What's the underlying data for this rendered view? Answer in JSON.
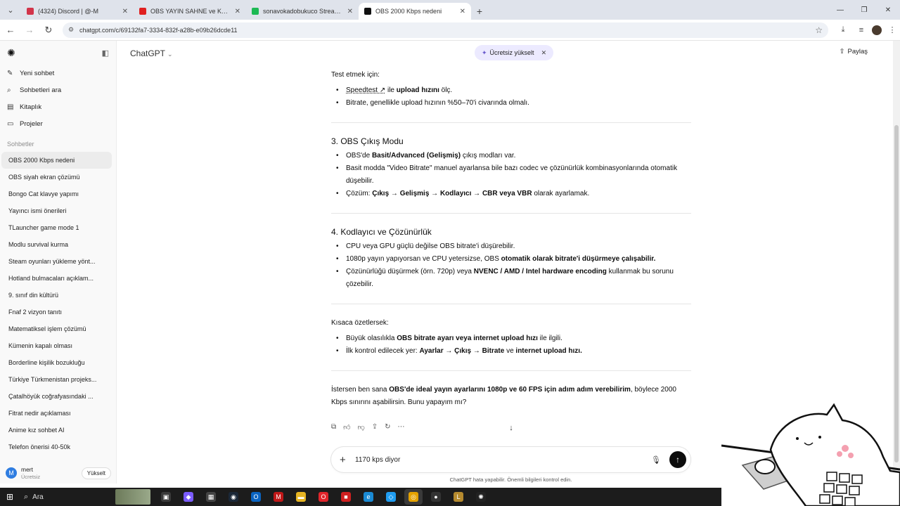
{
  "browser": {
    "tabs": [
      {
        "label": "(4324) Discord | @-M",
        "favicon_color": "#d2344a"
      },
      {
        "label": "OBS YAYIN SAHNE ve KAYNAK",
        "favicon_color": "#e02020"
      },
      {
        "label": "sonavokadobukuco Stream - W",
        "favicon_color": "#1db954"
      },
      {
        "label": "OBS 2000 Kbps nedeni",
        "favicon_color": "#111111"
      }
    ],
    "url": "chatgpt.com/c/69132fa7-3334-832f-a28b-e09b26dcde11"
  },
  "sidebar": {
    "actions": [
      {
        "icon": "edit-icon",
        "glyph": "✎",
        "label": "Yeni sohbet"
      },
      {
        "icon": "search-icon",
        "glyph": "⌕",
        "label": "Sohbetleri ara"
      },
      {
        "icon": "library-icon",
        "glyph": "▤",
        "label": "Kitaplık"
      },
      {
        "icon": "folder-icon",
        "glyph": "▭",
        "label": "Projeler"
      }
    ],
    "section_title": "Sohbetler",
    "chats": [
      "OBS 2000 Kbps nedeni",
      "OBS siyah ekran çözümü",
      "Bongo Cat klavye yapımı",
      "Yayıncı ismi önerileri",
      "TLauncher game mode 1",
      "Modlu survival kurma",
      "Steam oyunları yükleme yönt...",
      "Hotland bulmacaları açıklam...",
      "9. sınıf din kültürü",
      "Fnaf 2 vizyon tanıtı",
      "Matematiksel işlem çözümü",
      "Kümenin kapalı olması",
      "Borderline kişilik bozukluğu",
      "Türkiye Türkmenistan projeks...",
      "Çatalhöyük coğrafyasındaki ...",
      "Fitrat nedir açıklaması",
      "Anime kız sohbet AI",
      "Telefon önerisi 40-50k"
    ],
    "user": {
      "initial": "M",
      "name": "mert",
      "plan": "Ücretsiz",
      "upgrade_label": "Yükselt"
    }
  },
  "header": {
    "model": "ChatGPT",
    "upgrade_pill": "Ücretsiz yükselt",
    "share": "Paylaş"
  },
  "message": {
    "test_intro": "Test etmek için:",
    "test_items": [
      [
        {
          "t": "Speedtest ↗",
          "b": false,
          "link": true
        },
        {
          "t": " ile "
        },
        {
          "t": "upload hızını",
          "b": true
        },
        {
          "t": " ölç."
        }
      ],
      [
        {
          "t": "Bitrate, genellikle upload hızının %50–70'i civarında olmalı."
        }
      ]
    ],
    "sections": [
      {
        "title": "3. OBS Çıkış Modu",
        "items": [
          [
            {
              "t": "OBS'de "
            },
            {
              "t": "Basit/Advanced (Gelişmiş)",
              "b": true
            },
            {
              "t": " çıkış modları var."
            }
          ],
          [
            {
              "t": "Basit modda \"Video Bitrate\" manuel ayarlansa bile bazı codec ve çözünürlük kombinasyonlarında otomatik düşebilir."
            }
          ],
          [
            {
              "t": "Çözüm: "
            },
            {
              "t": "Çıkış → Gelişmiş → Kodlayıcı → CBR veya VBR",
              "b": true
            },
            {
              "t": " olarak ayarlamak."
            }
          ]
        ]
      },
      {
        "title": "4. Kodlayıcı ve Çözünürlük",
        "items": [
          [
            {
              "t": "CPU veya GPU güçlü değilse OBS bitrate'i düşürebilir."
            }
          ],
          [
            {
              "t": "1080p yayın yapıyorsan ve CPU yetersizse, OBS "
            },
            {
              "t": "otomatik olarak bitrate'i düşürmeye çalışabilir.",
              "b": true
            }
          ],
          [
            {
              "t": "Çözünürlüğü düşürmek (örn. 720p) veya "
            },
            {
              "t": "NVENC / AMD / Intel hardware encoding",
              "b": true
            },
            {
              "t": " kullanmak bu sorunu çözebilir."
            }
          ]
        ]
      }
    ],
    "summary_intro": "Kısaca özetlersek:",
    "summary_items": [
      [
        {
          "t": "Büyük olasılıkla "
        },
        {
          "t": "OBS bitrate ayarı veya internet upload hızı",
          "b": true
        },
        {
          "t": " ile ilgili."
        }
      ],
      [
        {
          "t": "İlk kontrol edilecek yer: "
        },
        {
          "t": "Ayarlar → Çıkış → Bitrate",
          "b": true
        },
        {
          "t": " ve "
        },
        {
          "t": "internet upload hızı.",
          "b": true
        }
      ]
    ],
    "closing": [
      {
        "t": "İstersen ben sana "
      },
      {
        "t": "OBS'de ideal yayın ayarlarını 1080p ve 60 FPS için adım adım verebilirim",
        "b": true
      },
      {
        "t": ", böylece 2000 Kbps sınırını aşabilirsin. Bunu yapayım mı?"
      }
    ]
  },
  "composer": {
    "value": "1170 kps diyor",
    "disclaimer": "ChatGPT hata yapabilir. Önemli bilgileri kontrol edin."
  },
  "taskbar": {
    "search_label": "Ara",
    "apps": [
      {
        "name": "task-view-icon",
        "color": "#3a3a3a",
        "glyph": "▣"
      },
      {
        "name": "copilot-icon",
        "color": "#7b5cff",
        "glyph": "◆"
      },
      {
        "name": "calculator-icon",
        "color": "#444",
        "glyph": "▦"
      },
      {
        "name": "steam-icon",
        "color": "#1b2838",
        "glyph": "◉"
      },
      {
        "name": "outlook-icon",
        "color": "#0a64c2",
        "glyph": "O"
      },
      {
        "name": "mcafee-icon",
        "color": "#c01818",
        "glyph": "M"
      },
      {
        "name": "explorer-icon",
        "color": "#e6b422",
        "glyph": "▬"
      },
      {
        "name": "opera-icon",
        "color": "#e0252b",
        "glyph": "O"
      },
      {
        "name": "roblox-icon",
        "color": "#d02020",
        "glyph": "■"
      },
      {
        "name": "edge-icon",
        "color": "#1a8ad4",
        "glyph": "e"
      },
      {
        "name": "vscode-icon",
        "color": "#1f9cf0",
        "glyph": "◇"
      },
      {
        "name": "chrome-icon",
        "color": "#e5a200",
        "glyph": "◎"
      },
      {
        "name": "obs-icon",
        "color": "#333",
        "glyph": "●"
      },
      {
        "name": "league-icon",
        "color": "#b58a2e",
        "glyph": "L"
      },
      {
        "name": "chatgpt-app-icon",
        "color": "#222",
        "glyph": "✺"
      }
    ]
  }
}
